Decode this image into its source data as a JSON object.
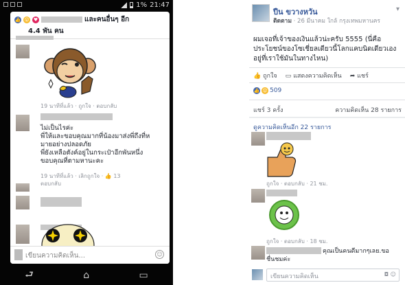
{
  "phone": {
    "status_battery": "1%",
    "status_time": "21:47",
    "header": {
      "names_suffix": "และคนอื่นๆ อีก",
      "count": "4.4 พัน คน"
    },
    "comments": [
      {
        "time": "19 นาทีที่แล้ว",
        "like": "ถูกใจ",
        "reply": "ตอบกลับ"
      },
      {
        "text": "ไม่เป็นไรค่ะ\nพี่ให้และขอบคุณมากที่น้องมาส่งพี่ถึงที่ห\nมายอย่างปลอดภัย\nพี่ยังเหลือตังค์อยู่ในกระเป๋าอีกพันหนึ่ง\nขอบคุณที่ตามหานะคะ",
        "time": "19 นาทีที่แล้ว",
        "unlike": "เลิกถูกใจ",
        "like_count": "13",
        "reply": "ตอบกลับ"
      }
    ],
    "input_placeholder": "เขียนความคิดเห็น...",
    "nav": {
      "back": "⮐",
      "home": "⌂",
      "recent": "▭"
    }
  },
  "fb": {
    "author": "ปืน ขวางหวัน",
    "follow": "ติดตาม",
    "subline": "· 26 มีนาคม ใกล้ กรุงเทพมหานคร",
    "post_text": "ผมเจอที่เจ้าของเงินแล้วน่ะครับ 5555 (นี่คือประโยชน์ของโซเชี่ยลเดียวนี้โลกแคบนิดเดียวเองอยู่ที่เราใช้มันในทางไหน)",
    "actions": {
      "like": "ถูกใจ",
      "comment": "แสดงความคิดเห็น",
      "share": "แชร์"
    },
    "reaction_count": "509",
    "shares": "แชร์ 3 ครั้ง",
    "comments_count": "ความคิดเห็น 28 รายการ",
    "view_previous": "ดูความคิดเห็นอีก 22 รายการ",
    "comment1_meta": {
      "like": "ถูกใจ",
      "reply": "ตอบกลับ",
      "time": "21 ชม."
    },
    "comment2_meta": {
      "like": "ถูกใจ",
      "reply": "ตอบกลับ",
      "time": "18 ชม."
    },
    "comment3_text": "คุณเป็นคนดีมากๆเลย.ขอชื่นชมค่ะ",
    "input_placeholder": "เขียนความคิดเห็น"
  },
  "colors": {
    "fb_blue": "#4267b2",
    "link": "#365899",
    "bg": "#e9ebee"
  }
}
